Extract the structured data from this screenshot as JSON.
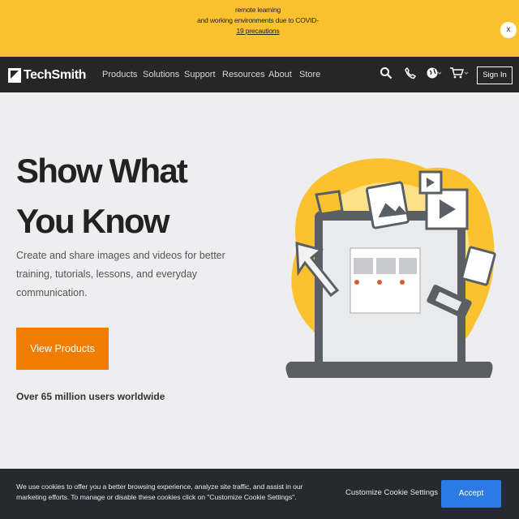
{
  "banner": {
    "lines": [
      "remote learning",
      "and working environments due to COVID-",
      "19 precautions"
    ],
    "close_label": "x"
  },
  "nav": {
    "logo_text": "TechSmith",
    "items": [
      "Products",
      "Solutions",
      "Support",
      "Resources",
      "About",
      "Store"
    ],
    "signin_label": "Sign In",
    "icons": [
      "search-icon",
      "phone-icon",
      "globe-icon",
      "cart-icon"
    ]
  },
  "hero": {
    "title_line1": "Show What",
    "title_line2": "You Know",
    "description": "Create and share images and videos for better training, tutorials, lessons, and everyday communication.",
    "cta_label": "View Products",
    "users_text": "Over 65 million users worldwide"
  },
  "cookie": {
    "text": "We use cookies to offer you a better browsing experience, analyze site traffic, and assist in our marketing efforts. To manage or disable these cookies click on \"Customize Cookie Settings\".",
    "customize_label": "Customize Cookie Settings",
    "accept_label": "Accept"
  },
  "colors": {
    "banner": "#fbc12e",
    "nav": "#262626",
    "cta": "#f07d00",
    "accept": "#2c7be5",
    "illustration_yellow": "#fbc12e"
  }
}
